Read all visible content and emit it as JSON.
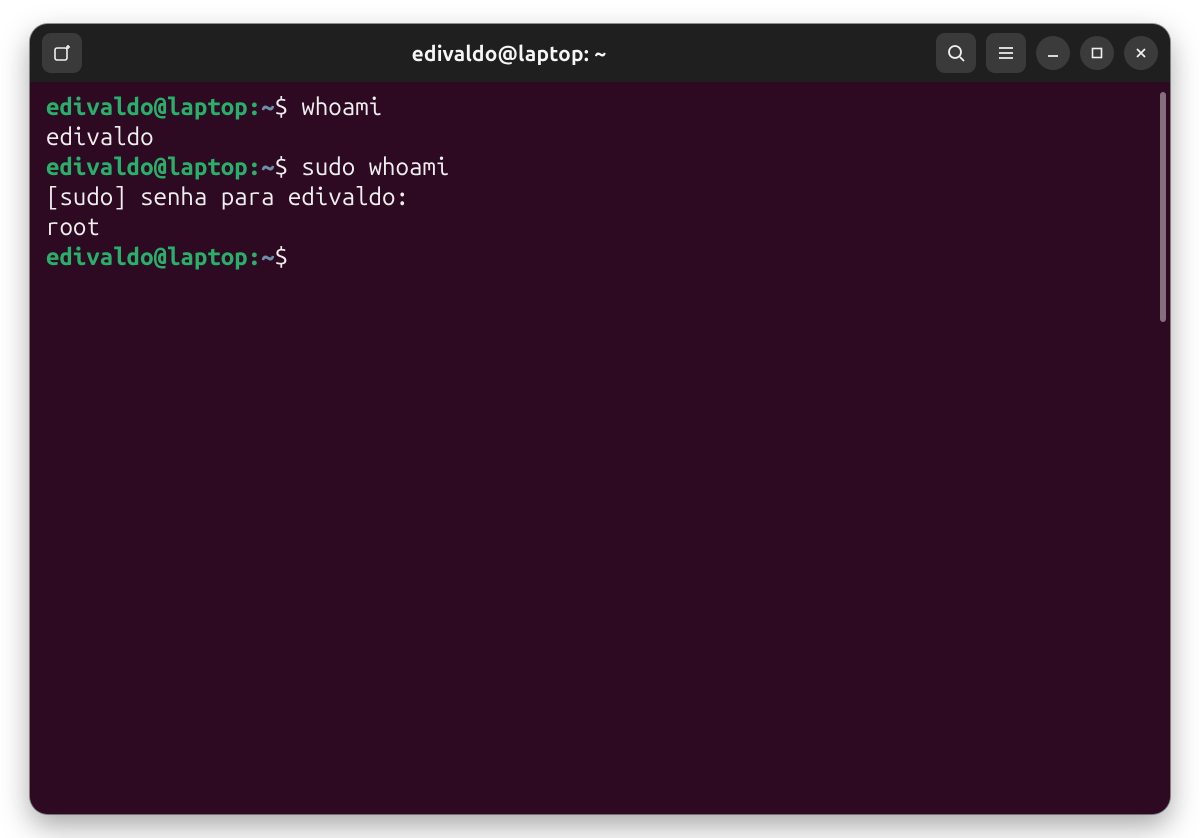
{
  "window": {
    "title": "edivaldo@laptop: ~"
  },
  "prompt": {
    "userhost": "edivaldo@laptop",
    "sep": ":",
    "path": "~",
    "symbol": "$"
  },
  "lines": {
    "cmd1": "whoami",
    "out1": "edivaldo",
    "cmd2": "sudo whoami",
    "out2": "[sudo] senha para edivaldo:",
    "out3": "root"
  }
}
